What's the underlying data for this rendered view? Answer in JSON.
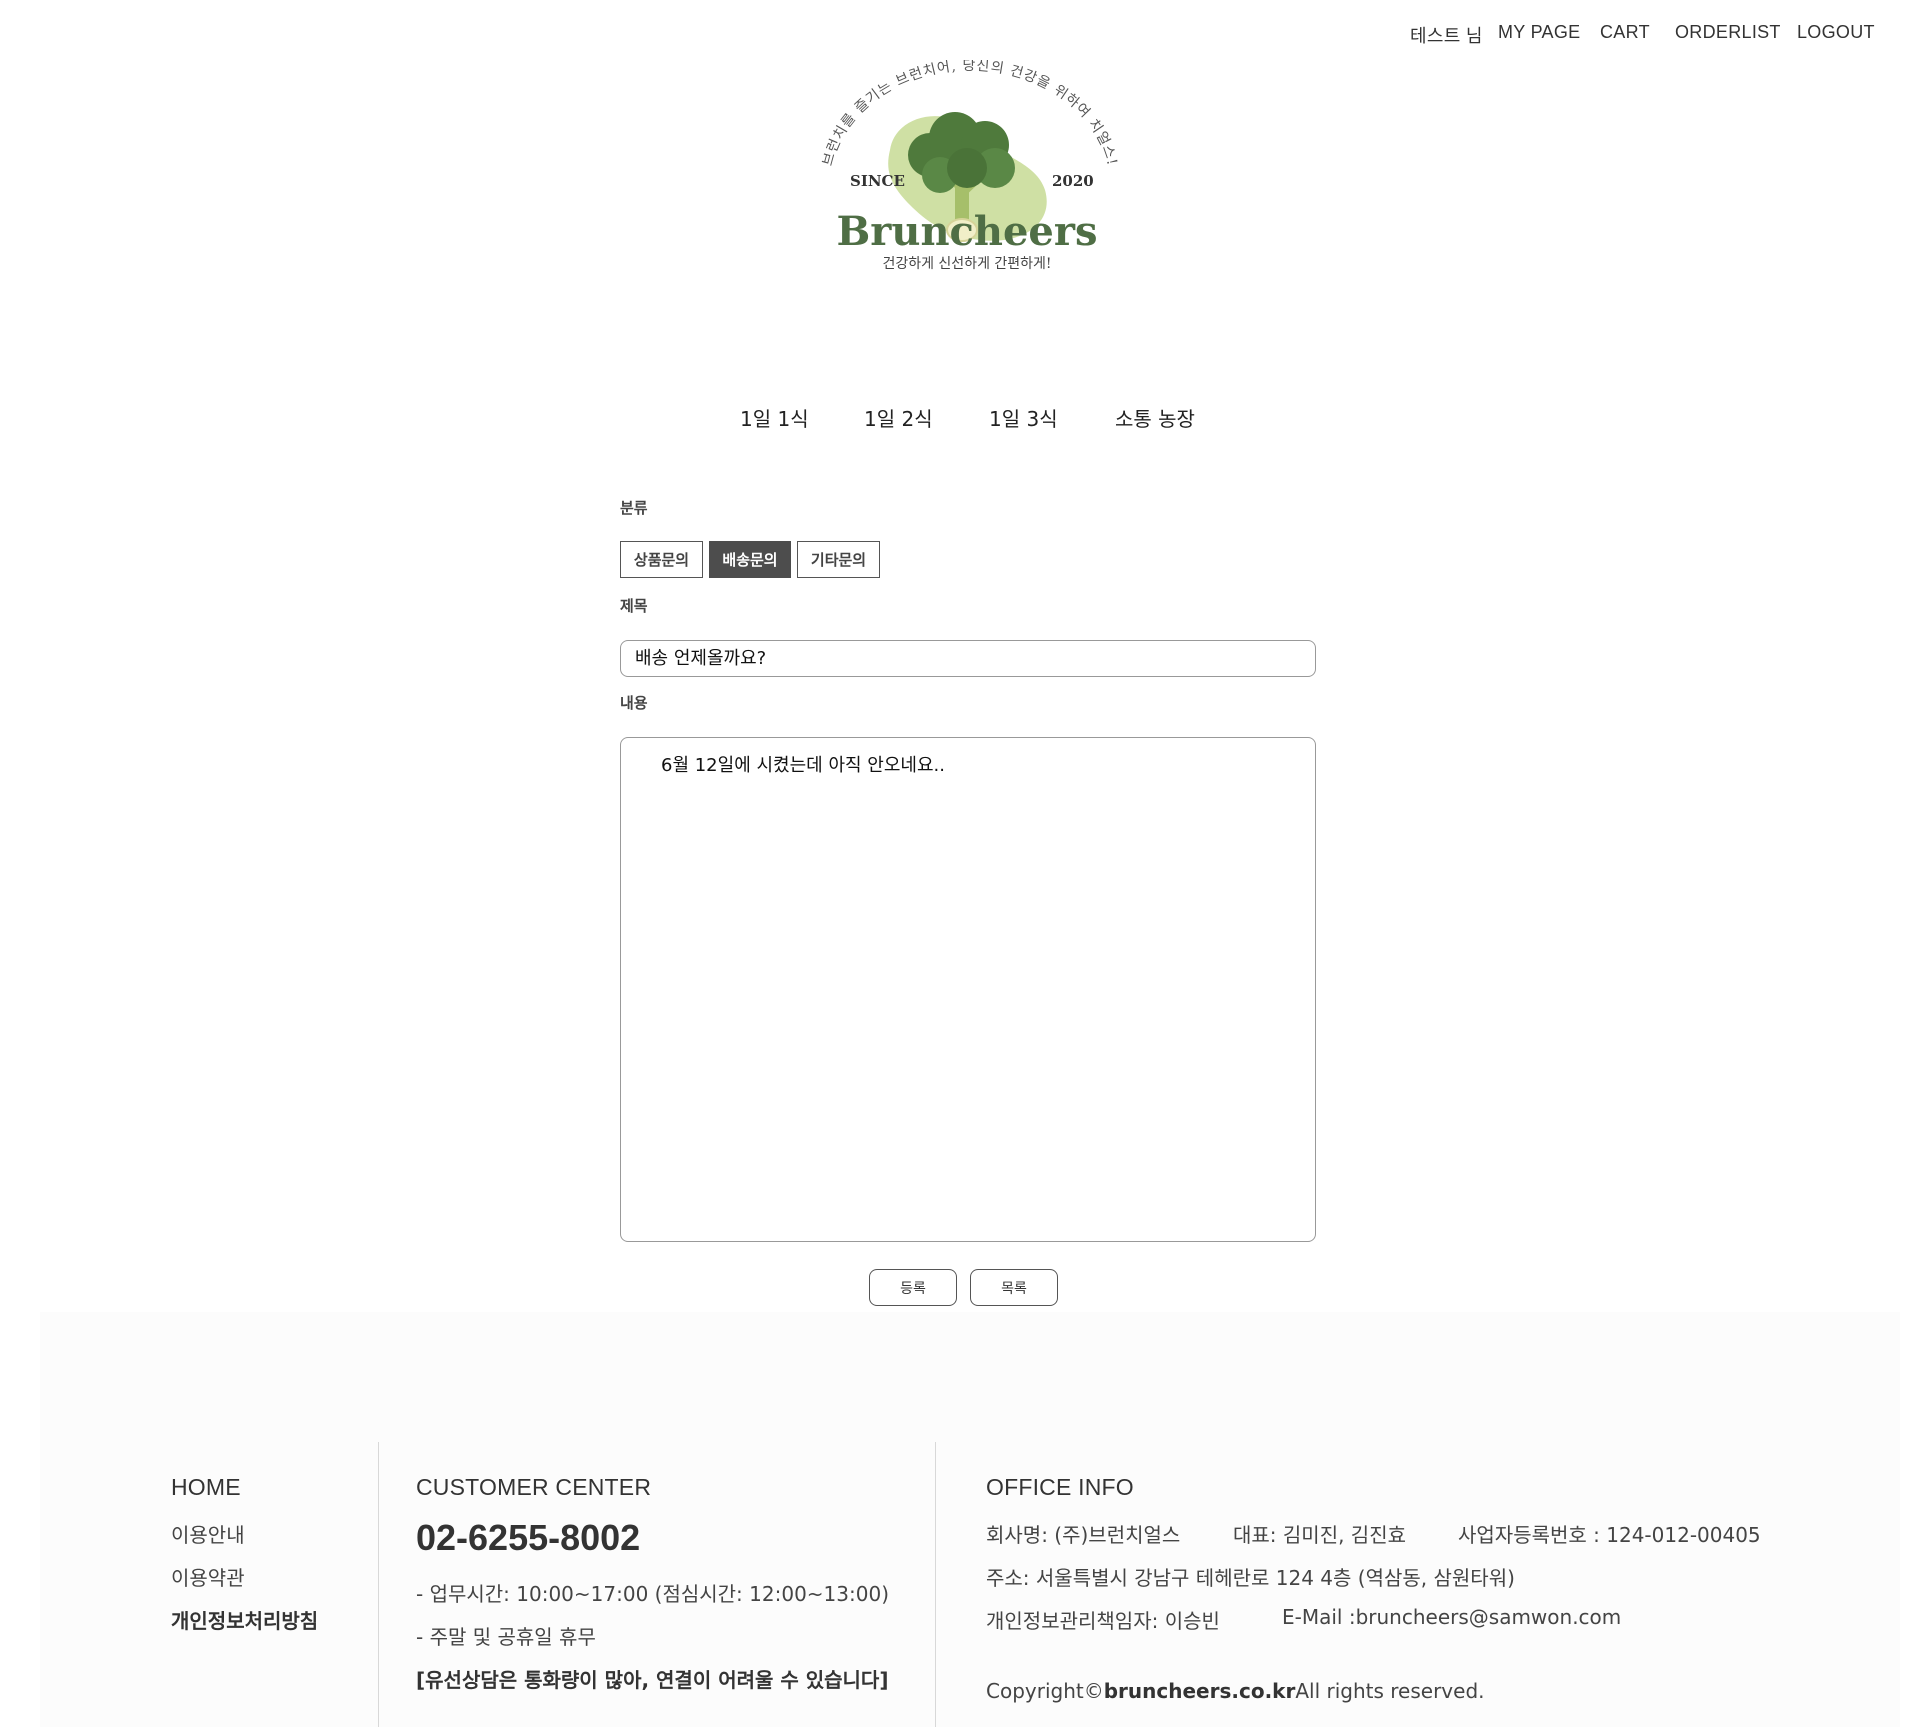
{
  "topnav": {
    "user": "테스트 님",
    "mypage": "MY PAGE",
    "cart": "CART",
    "orderlist": "ORDERLIST",
    "logout": "LOGOUT"
  },
  "logo": {
    "arc_text": "브런치를 즐기는 브런치어, 당신의 건강을 위하여 치얼스!",
    "since": "SINCE",
    "year": "2020",
    "brand": "Bruncheers",
    "tagline": "건강하게 신선하게 간편하게!",
    "colors": {
      "blob": "#cfe0a4",
      "broccoli": "#4f7a3c",
      "brand": "#4f6e45"
    }
  },
  "category_nav": [
    "1일 1식",
    "1일 2식",
    "1일 3식",
    "소통 농장"
  ],
  "form": {
    "category_label": "분류",
    "categories": [
      "상품문의",
      "배송문의",
      "기타문의"
    ],
    "selected_category": "배송문의",
    "title_label": "제목",
    "title_value": "배송 언제올까요?",
    "content_label": "내용",
    "content_value": "6월 12일에 시켰는데 아직 안오네요..",
    "submit_label": "등록",
    "list_label": "목록"
  },
  "footer": {
    "home": {
      "heading": "HOME",
      "links": [
        "이용안내",
        "이용약관",
        "개인정보처리방침"
      ]
    },
    "customer_center": {
      "heading": "CUSTOMER CENTER",
      "phone": "02-6255-8002",
      "hours": "- 업무시간: 10:00~17:00 (점심시간: 12:00~13:00)",
      "holiday": "- 주말 및 공휴일 휴무",
      "notice": "[유선상담은 통화량이 많아, 연결이 어려울 수 있습니다]"
    },
    "office_info": {
      "heading": "OFFICE INFO",
      "company": "회사명: (주)브런치얼스",
      "ceo": "대표: 김미진, 김진효",
      "biz_no": "사업자등록번호 : 124-012-00405",
      "address": "주소: 서울특별시 강남구 테헤란로 124 4층 (역삼동, 삼원타워)",
      "privacy_officer": "개인정보관리책임자: 이승빈",
      "email": "E-Mail :bruncheers@samwon.com",
      "copyright_prefix": "Copyright©",
      "copyright_domain": "bruncheers.co.kr",
      "copyright_suffix": "All rights reserved."
    }
  }
}
